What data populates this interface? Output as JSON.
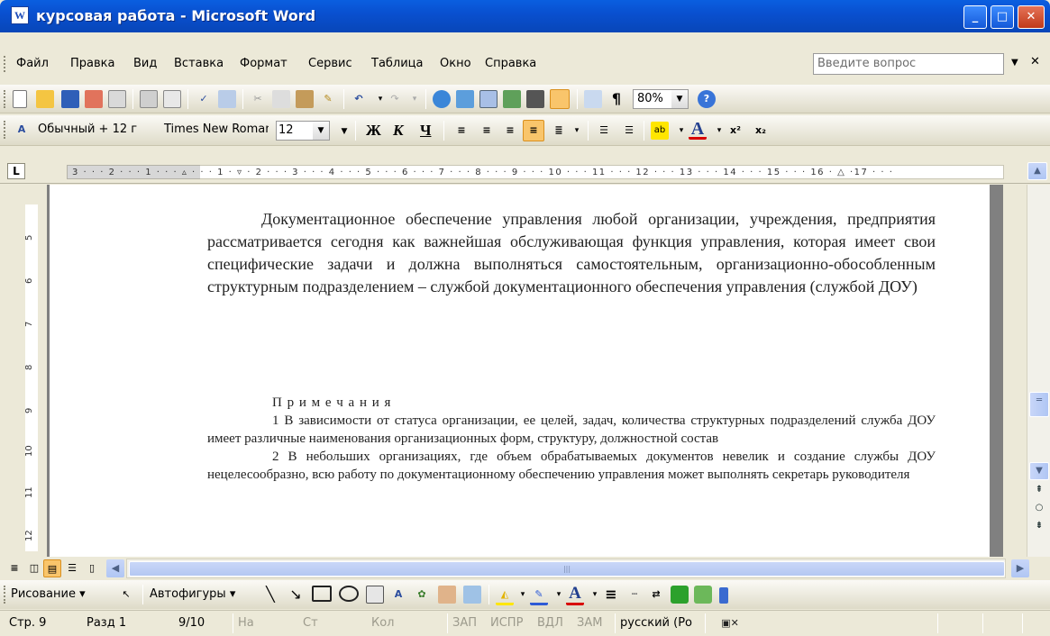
{
  "window": {
    "title": "курсовая работа - Microsoft Word",
    "app_icon": "word-icon"
  },
  "menu": {
    "items": [
      "Файл",
      "Правка",
      "Вид",
      "Вставка",
      "Формат",
      "Сервис",
      "Таблица",
      "Окно",
      "Справка"
    ],
    "ask_placeholder": "Введите вопрос"
  },
  "standard_toolbar": {
    "zoom": "80%",
    "pilcrow": "¶"
  },
  "formatting_toolbar": {
    "style": "Обычный + 12 г",
    "font": "Times New Roman",
    "size": "12",
    "bold": "Ж",
    "italic": "К",
    "underline": "Ч",
    "font_color": "A",
    "superscript": "x²",
    "subscript": "x₂"
  },
  "ruler": {
    "tab_selector": "L",
    "horizontal_numbers": "3 · · · 2 · · · 1 · · · ▵ · · · 1 · ▿ · 2 · · · 3 · · · 4 · · · 5 · · · 6 · · · 7 · · · 8 · · · 9 · · · 10 · · · 11 · · · 12 · · · 13 · · · 14 · · · 15 · · · 16 · △ ·17 · · ·",
    "vertical_numbers": [
      "5",
      "6",
      "7",
      "8",
      "9",
      "10",
      "11",
      "12"
    ]
  },
  "document": {
    "paragraph": "Документационное обеспечение управления любой организации, учреждения, предприятия рассматривается сегодня как важнейшая обслуживающая функция управления, которая имеет свои специфические задачи и должна выполняться самостоятельным, организационно-обособленным структурным подразделением – службой документационного обеспечения управления (службой ДОУ)",
    "notes_heading": "П р и м е ч а н и я",
    "note1": "1 В зависимости от статуса организации, ее целей, задач, количества структурных подразделений служба ДОУ имеет различные наименования организационных форм, структуру, должностной состав",
    "note2": "2 В небольших организациях, где объем обрабатываемых документов невелик и создание службы ДОУ нецелесообразно, всю работу по документационному обеспечению управления может выполнять секретарь руководителя"
  },
  "drawing_toolbar": {
    "draw": "Рисование ▾",
    "autoshapes": "Автофигуры ▾",
    "font_color": "A"
  },
  "status_bar": {
    "page": "Стр. 9",
    "section": "Разд 1",
    "pages": "9/10",
    "at": "На",
    "line": "Ст",
    "col": "Кол",
    "rec": "ЗАП",
    "trk": "ИСПР",
    "ext": "ВДЛ",
    "ovr": "ЗАМ",
    "language": "русский (Ро"
  },
  "colors": {
    "title_bar": "#0A5FE0",
    "toolbar": "#ECE9D8",
    "doc_bg": "#808080"
  }
}
